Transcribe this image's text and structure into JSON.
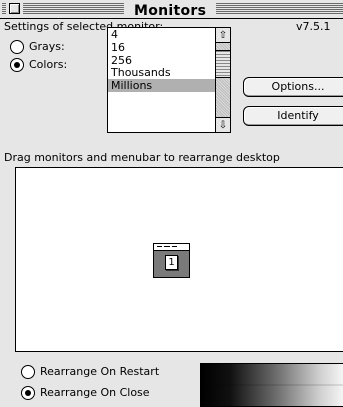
{
  "window": {
    "title": "Monitors"
  },
  "settings": {
    "heading": "Settings of selected monitor:",
    "version": "v7.5.1"
  },
  "mode": {
    "grays_label": "Grays:",
    "colors_label": "Colors:",
    "selected": "colors"
  },
  "depth_list": {
    "items": [
      "4",
      "16",
      "256",
      "Thousands",
      "Millions"
    ],
    "selected": "Millions"
  },
  "buttons": {
    "options": "Options...",
    "identify": "Identify"
  },
  "arrange": {
    "instruction": "Drag monitors and menubar to rearrange desktop",
    "monitor_number": "1"
  },
  "rearrange": {
    "on_restart": "Rearrange On Restart",
    "on_close": "Rearrange On Close",
    "selected": "on_close"
  },
  "icons": {
    "close_box": "close-box-icon",
    "scroll_up": "up-arrow-icon",
    "scroll_down": "down-arrow-icon"
  },
  "colors": {
    "window_bg": "#e6e6e6",
    "selection": "#b0b0b0",
    "monitor": "#7a7a7a"
  }
}
